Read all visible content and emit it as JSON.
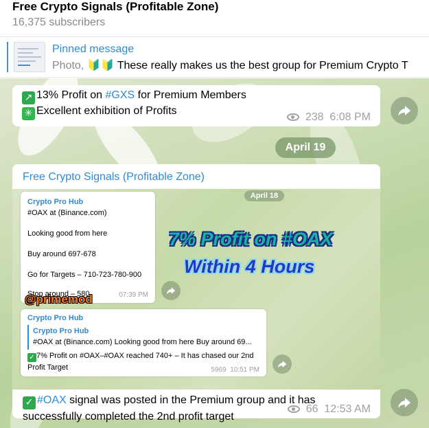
{
  "header": {
    "title": "Free Crypto Signals (Profitable Zone)",
    "subscribers": "16,375 subscribers"
  },
  "pinned": {
    "title": "Pinned message",
    "photo_label": "Photo,",
    "emoji": "🔰🔰",
    "text": "These really makes us the best group for Premium Crypto T"
  },
  "messages": [
    {
      "line1_pre": "13% Profit on ",
      "line1_tag": "#GXS",
      "line1_post": " for Premium Members",
      "line2": "Excellent exhibition of Profits",
      "views": "238",
      "time": "6:08 PM"
    },
    {
      "sender": "Free Crypto Signals (Profitable Zone)",
      "caption_tag": "#OAX",
      "caption_text": " signal was posted in the Premium group and it has successfully completed the 2nd profit target",
      "views": "66",
      "time": "12:53 AM"
    }
  ],
  "date_separator": "April 19",
  "photo": {
    "date_chip": "April 18",
    "card1": {
      "name": "Crypto Pro Hub",
      "line1": "#OAX at (Binance.com)",
      "line2": "Looking good from here",
      "line3": "Buy around 697-678",
      "line4": "Go for Targets – 710-723-780-900",
      "line5": "Stop around – 580",
      "time": "07:39 PM"
    },
    "headline1": "7% Profit on #OAX",
    "headline2": "Within 4 Hours",
    "watermark": "@primemod",
    "card2": {
      "name": "Crypto Pro Hub",
      "reply_name": "Crypto Pro Hub",
      "reply_text": "#OAX at (Binance.com)  Looking good from here  Buy around 69...",
      "text": "7% Profit on #OAX–#OAX reached 740+ – It has chased our 2nd Profit Target",
      "views": "5969",
      "time": "10:51 PM"
    }
  },
  "colors": {
    "accent": "#2f8bd1",
    "check": "#2fa84f"
  },
  "icons": [
    "share-icon",
    "eye-icon",
    "check-emoji-icon",
    "sparkle-emoji-icon",
    "chart-emoji-icon"
  ]
}
